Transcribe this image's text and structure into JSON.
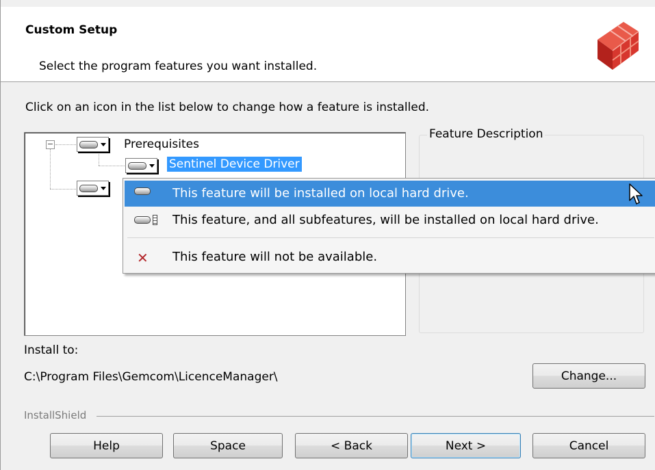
{
  "header": {
    "title": "Custom Setup",
    "subtitle": "Select the program features you want installed."
  },
  "instruction": "Click on an icon in the list below to change how a feature is installed.",
  "tree": {
    "items": [
      {
        "label": "Prerequisites",
        "expander": "−"
      },
      {
        "label": "Sentinel Device Driver"
      }
    ]
  },
  "feature_description": {
    "legend": "Feature Description"
  },
  "popup_menu": {
    "items": [
      {
        "label": "This feature will be installed on local hard drive.",
        "icon": "hard-drive-icon"
      },
      {
        "label": "This feature, and all subfeatures, will be installed on local hard drive.",
        "icon": "hard-drive-subfeatures-icon"
      },
      {
        "label": "This feature will not be available.",
        "icon": "red-x-icon",
        "glyph": "✕"
      }
    ]
  },
  "install_to": {
    "label": "Install to:",
    "path": "C:\\Program Files\\Gemcom\\LicenceManager\\"
  },
  "buttons": {
    "change": "Change...",
    "help": "Help",
    "space": "Space",
    "back": "< Back",
    "next": "Next >",
    "cancel": "Cancel"
  },
  "footer": {
    "brand": "InstallShield"
  },
  "colors": {
    "selection": "#3399ff",
    "menu_highlight": "#3c8ddb",
    "logo_red": "#d7372e"
  }
}
